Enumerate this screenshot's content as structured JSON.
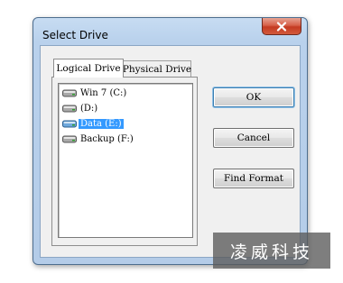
{
  "window": {
    "title": "Select Drive"
  },
  "tabs": [
    {
      "label": "Logical Drive",
      "active": true
    },
    {
      "label": "Physical Drive",
      "active": false
    }
  ],
  "drives": [
    {
      "label": "Win 7 (C:)",
      "icon": "hard-drive-icon",
      "selected": false
    },
    {
      "label": "(D:)",
      "icon": "hard-drive-icon",
      "selected": false
    },
    {
      "label": "Data (E:)",
      "icon": "hard-drive-icon",
      "selected": true
    },
    {
      "label": "Backup (F:)",
      "icon": "hard-drive-icon",
      "selected": false
    }
  ],
  "buttons": {
    "ok": "OK",
    "cancel": "Cancel",
    "find_format": "Find Format"
  },
  "watermark": "凌威科技",
  "colors": {
    "selection": "#3399ff",
    "close_button": "#c43b22",
    "frame": "#b9d1ec"
  }
}
